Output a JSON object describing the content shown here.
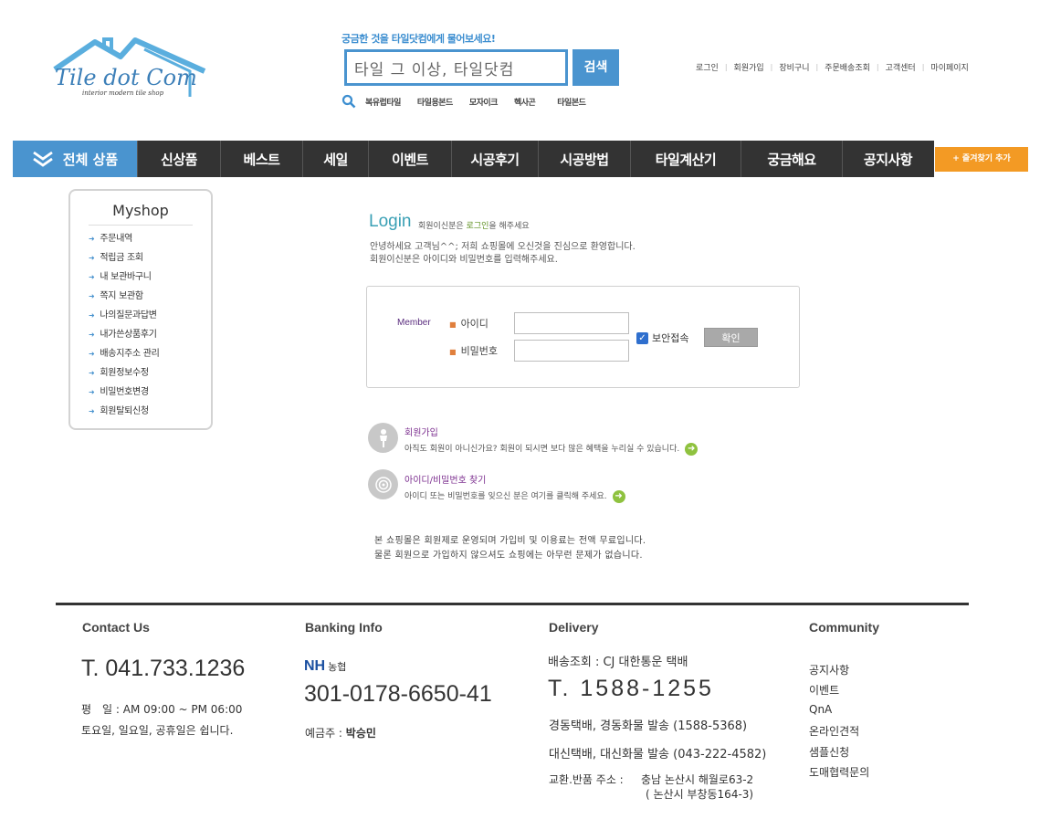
{
  "header": {
    "logo_text": "Tile dot Com",
    "logo_sub": "interior modern tile shop",
    "search_tagline": "궁금한 것을 타일닷컴에게 물어보세요!",
    "search_value": "타일 그 이상, 타일닷컴",
    "search_button": "검색",
    "keywords": [
      "복유럽타일",
      "타일용본드",
      "모자이크",
      "헥사곤",
      "타일본드"
    ],
    "top_links": [
      "로그인",
      "회원가입",
      "장비구니",
      "주문배송조회",
      "고객센터",
      "마이페이지"
    ]
  },
  "nav": {
    "all_label": "전체 상품",
    "items": [
      "신상품",
      "베스트",
      "세일",
      "이벤트",
      "시공후기",
      "시공방법",
      "타일계산기",
      "궁금해요",
      "공지사항"
    ],
    "favorite_label": "+ 즐겨찾기 추가"
  },
  "myshop": {
    "title": "Myshop",
    "items": [
      "주문내역",
      "적립금 조회",
      "내 보관바구니",
      "쪽지 보관함",
      "나의질문과답변",
      "내가쓴상품후기",
      "배송지주소 관리",
      "회원정보수정",
      "비밀번호변경",
      "회원탈퇴신청"
    ]
  },
  "login": {
    "heading": "Login",
    "sub_prefix": "회원이신분은 ",
    "sub_highlight": "로그인",
    "sub_suffix": "을 해주세요",
    "welcome_line1": "안녕하세요 고객님^^; 저희 쇼핑몰에 오신것을 진심으로 환영합니다.",
    "welcome_line2": "회원이신분은 아이디와 비밀번호를 입력해주세요.",
    "member_label": "Member",
    "id_label": "아이디",
    "pw_label": "비밀번호",
    "secure_label": "보안접속",
    "confirm_button": "확인",
    "join_title": "회원가입",
    "join_desc": "아직도 회원이 아니신가요? 회원이 되시면 보다 많은 혜택을 누리실 수 있습니다.",
    "find_title": "아이디/비밀번호 찾기",
    "find_desc": "아이디 또는 비밀번호를 잊으신 분은 여기를 클릭해 주세요.",
    "notice_line1": "본 쇼핑몰은 회원제로 운영되며 가입비 및 이용료는 전액 무료입니다.",
    "notice_line2": "물론 회원으로 가입하지 않으셔도 쇼핑에는 아무런 문제가 없습니다."
  },
  "footer": {
    "contact": {
      "title": "Contact Us",
      "phone": "T. 041.733.1236",
      "hours": "평　일 : AM 09:00 ~ PM 06:00",
      "closed": "토요일, 일요일, 공휴일은 쉽니다."
    },
    "banking": {
      "title": "Banking Info",
      "bank_logo": "NH",
      "bank_name": "농협",
      "account": "301-0178-6650-41",
      "holder_label": "예금주 : ",
      "holder": "박승민"
    },
    "delivery": {
      "title": "Delivery",
      "tracking": "배송조회 : CJ 대한통운 택배",
      "phone": "T. 1588-1255",
      "kd": "경동택배, 경동화물 발송 (1588-5368)",
      "ds": "대신택배, 대신화물 발송 (043-222-4582)",
      "return_label": "교환.반품 주소 :",
      "return_addr1": "충남 논산시 해월로63-2",
      "return_addr2": "( 논산시 부창동164-3)"
    },
    "community": {
      "title": "Community",
      "items": [
        "공지사항",
        "이벤트",
        "QnA",
        "온라인견적",
        "샘플신청",
        "도매협력문의"
      ]
    }
  },
  "colors": {
    "brand_blue": "#4a94cf",
    "nav_dark": "#333333",
    "favorite_orange": "#f39a24",
    "login_teal": "#3aa0b5",
    "link_purple": "#7c2f8f"
  }
}
